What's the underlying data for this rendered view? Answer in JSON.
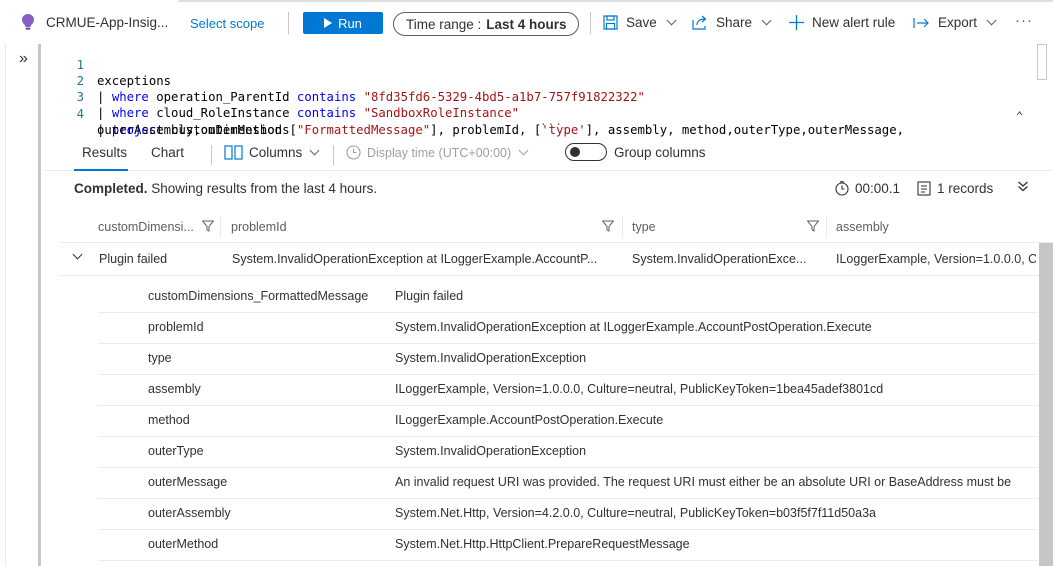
{
  "toolbar": {
    "scope_name": "CRMUE-App-Insig...",
    "select_scope": "Select scope",
    "run": "Run",
    "time_range_label": "Time range :",
    "time_range_value": "Last 4 hours",
    "save": "Save",
    "share": "Share",
    "new_alert_rule": "New alert rule",
    "export": "Export",
    "more": "···"
  },
  "rail": {
    "expand": "»"
  },
  "editor": {
    "line_numbers": [
      "1",
      "2",
      "3",
      "4"
    ],
    "line1": "exceptions",
    "line2": {
      "pipe": "| ",
      "kw1": "where",
      "mid": " operation_ParentId ",
      "kw2": "contains",
      "sp": " ",
      "str": "\"8fd35fd6-5329-4bd5-a1b7-757f91822322\""
    },
    "line3": {
      "pipe": "| ",
      "kw1": "where",
      "mid": " cloud_RoleInstance ",
      "kw2": "contains",
      "sp": " ",
      "str": "\"SandboxRoleInstance\""
    },
    "line4": {
      "pipe": "| ",
      "kw1": "project",
      "a": " customDimensions[",
      "s1": "\"FormattedMessage\"",
      "b": "], problemId, [",
      "s2": "'type'",
      "c": "], assembly, method,outerType,outerMessage,"
    },
    "line4_wrap": "outerAssembly,outerMethod",
    "splitter": "···",
    "collapse": "⌃"
  },
  "results_bar": {
    "tab_results": "Results",
    "tab_chart": "Chart",
    "columns": "Columns",
    "display_time": "Display time (UTC+00:00)",
    "group_columns": "Group columns"
  },
  "status": {
    "completed": "Completed.",
    "message": " Showing results from the last 4 hours.",
    "duration": "00:00.1",
    "records": "1 records"
  },
  "grid": {
    "headers": [
      "customDimensi...",
      "problemId",
      "type",
      "assembly"
    ],
    "row": [
      "Plugin failed",
      "System.InvalidOperationException at ILoggerExample.AccountP...",
      "System.InvalidOperationExce...",
      "ILoggerExample, Version=1.0.0.0, C"
    ],
    "details": [
      {
        "key": "customDimensions_FormattedMessage",
        "value": "Plugin failed"
      },
      {
        "key": "problemId",
        "value": "System.InvalidOperationException at ILoggerExample.AccountPostOperation.Execute"
      },
      {
        "key": "type",
        "value": "System.InvalidOperationException"
      },
      {
        "key": "assembly",
        "value": "ILoggerExample, Version=1.0.0.0, Culture=neutral, PublicKeyToken=1bea45adef3801cd"
      },
      {
        "key": "method",
        "value": "ILoggerExample.AccountPostOperation.Execute"
      },
      {
        "key": "outerType",
        "value": "System.InvalidOperationException"
      },
      {
        "key": "outerMessage",
        "value": "An invalid request URI was provided. The request URI must either be an absolute URI or BaseAddress must be"
      },
      {
        "key": "outerAssembly",
        "value": "System.Net.Http, Version=4.2.0.0, Culture=neutral, PublicKeyToken=b03f5f7f11d50a3a"
      },
      {
        "key": "outerMethod",
        "value": "System.Net.Http.HttpClient.PrepareRequestMessage"
      }
    ]
  },
  "colors": {
    "accent": "#0078d4",
    "keyword": "#0000ff",
    "string": "#a31515",
    "line_number": "#237893",
    "scope_icon": "#8661c5"
  }
}
